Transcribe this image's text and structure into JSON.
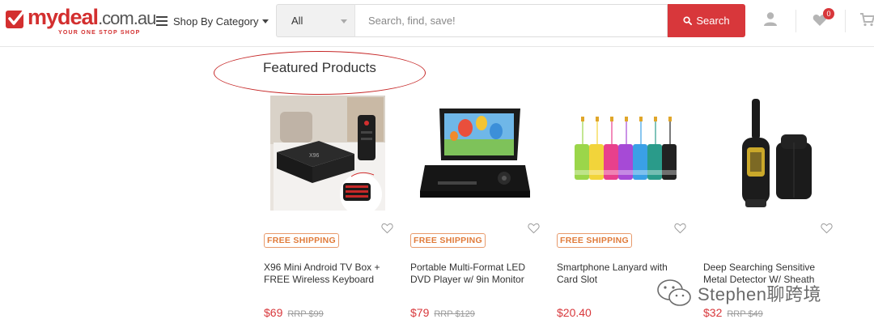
{
  "header": {
    "logo": {
      "brand_a": "my",
      "brand_b": "deal",
      "brand_c": ".com.au",
      "tagline": "YOUR ONE STOP SHOP"
    },
    "shop_by_category": "Shop By Category",
    "search": {
      "category_selected": "All",
      "placeholder": "Search, find, save!",
      "button_label": "Search"
    },
    "wishlist_count": "0",
    "accent_color": "#d8373b"
  },
  "featured": {
    "title": "Featured Products",
    "products": [
      {
        "name": "X96 Mini Android TV Box + FREE Wireless Keyboard",
        "badge": "FREE SHIPPING",
        "price": "$69",
        "rrp": "RRP $99",
        "image": "tv-box-with-keyboard"
      },
      {
        "name": "Portable Multi-Format LED DVD Player w/ 9in Monitor",
        "badge": "FREE SHIPPING",
        "price": "$79",
        "rrp": "RRP $129",
        "image": "portable-dvd-player"
      },
      {
        "name": "Smartphone Lanyard with Card Slot",
        "badge": "FREE SHIPPING",
        "price": "$20.40",
        "rrp": "",
        "image": "colorful-lanyards"
      },
      {
        "name": "Deep Searching Sensitive Metal Detector W/ Sheath",
        "badge": "",
        "price": "$32",
        "rrp": "RRP $49",
        "image": "metal-detector"
      }
    ]
  },
  "watermark": {
    "text": "Stephen聊跨境"
  }
}
